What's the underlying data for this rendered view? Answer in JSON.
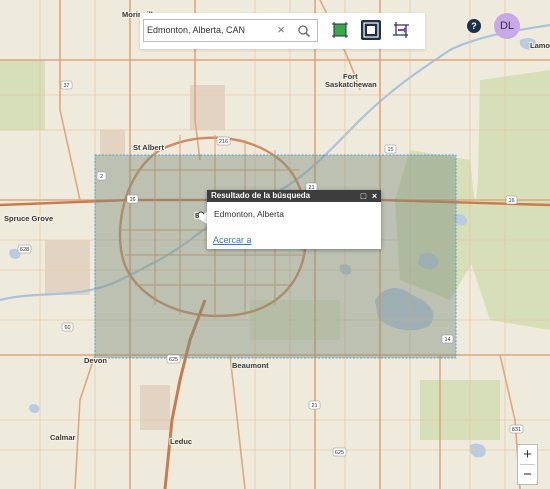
{
  "search": {
    "value": "Edmonton, Alberta, CAN",
    "clear_glyph": "×"
  },
  "toolbar": {
    "tools": [
      {
        "name": "select-extent-tool",
        "icon": "square-select-icon",
        "active": false
      },
      {
        "name": "current-extent-tool",
        "icon": "map-extent-icon",
        "active": true
      },
      {
        "name": "draw-extent-tool",
        "icon": "crop-arrow-icon",
        "active": false
      }
    ]
  },
  "help_label": "?",
  "user": {
    "initials": "DL"
  },
  "popup": {
    "title": "Resultado de la búsqueda",
    "address": "Edmonton, Alberta",
    "zoom_link": "Acercar a",
    "maximize_glyph": "□",
    "close_glyph": "×"
  },
  "zoom": {
    "in": "+",
    "out": "−"
  },
  "map": {
    "places": {
      "morinville": "Morinville",
      "lamont": "Lamo",
      "fort_sask": "Fort\nSaskatchewan",
      "st_albert": "St Albert",
      "spruce_grove": "Spruce Grove",
      "edmonton_partial": "E",
      "devon": "Devon",
      "beaumont": "Beaumont",
      "calmar": "Calmar",
      "leduc": "Leduc"
    },
    "shields": [
      "37",
      "216",
      "15",
      "2",
      "16",
      "16",
      "628",
      "21",
      "14",
      "60",
      "625",
      "21",
      "831",
      "625"
    ],
    "colors": {
      "land": "#efebdc",
      "green": "#d6dfb8",
      "road": "#e0a67c",
      "water": "#b8cbe0",
      "urban": "#e4c1b0",
      "extent_fill": "#7f8f7e",
      "extent_border": "#4aa8d8"
    }
  }
}
